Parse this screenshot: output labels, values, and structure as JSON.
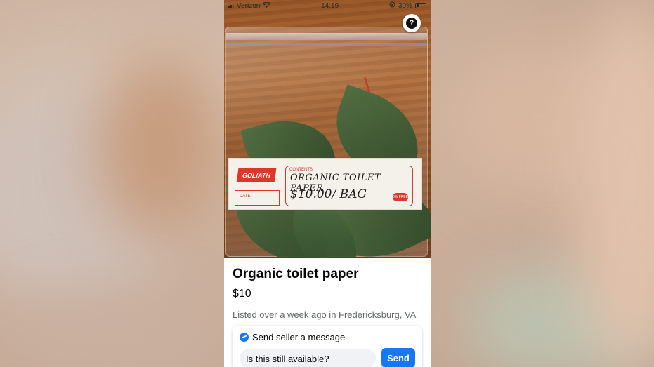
{
  "status_bar": {
    "carrier": "Verizon",
    "time": "14:19",
    "battery": "30%"
  },
  "photo": {
    "label_brand": "GOLIATH",
    "label_date": "DATE",
    "label_contents": "CONTENTS",
    "handwriting_line1": "ORGANIC TOILET PAPER",
    "handwriting_line2": "$10.00/ BAG",
    "label_badge": "0% FREE"
  },
  "help_button": {
    "icon": "question-icon",
    "label": "?"
  },
  "listing": {
    "title": "Organic toilet paper",
    "price": "$10",
    "meta": "Listed over a week ago in Fredericksburg, VA"
  },
  "message": {
    "header": "Send seller a message",
    "input_value": "Is this still available?",
    "send_label": "Send",
    "accent": "#1877f2"
  }
}
